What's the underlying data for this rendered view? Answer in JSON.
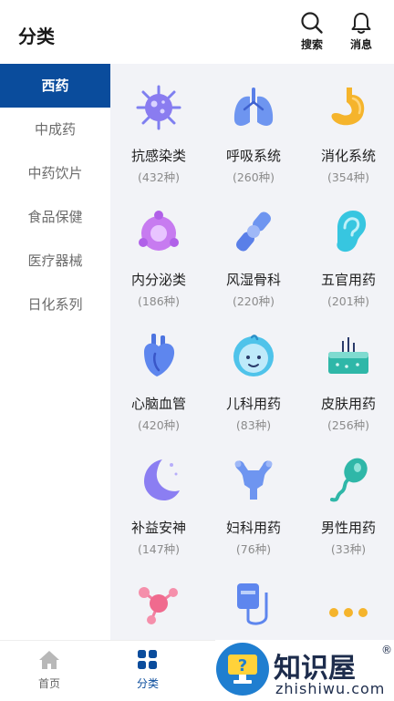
{
  "header": {
    "title": "分类",
    "search_label": "搜索",
    "message_label": "消息"
  },
  "sidebar": {
    "items": [
      {
        "label": "西药",
        "active": true
      },
      {
        "label": "中成药"
      },
      {
        "label": "中药饮片"
      },
      {
        "label": "食品保健"
      },
      {
        "label": "医疗器械"
      },
      {
        "label": "日化系列"
      }
    ]
  },
  "categories": [
    {
      "name": "抗感染类",
      "count": "(432种)",
      "icon": "virus-icon"
    },
    {
      "name": "呼吸系统",
      "count": "(260种)",
      "icon": "lungs-icon"
    },
    {
      "name": "消化系统",
      "count": "(354种)",
      "icon": "stomach-icon"
    },
    {
      "name": "内分泌类",
      "count": "(186种)",
      "icon": "gland-icon"
    },
    {
      "name": "风湿骨科",
      "count": "(220种)",
      "icon": "bone-joint-icon"
    },
    {
      "name": "五官用药",
      "count": "(201种)",
      "icon": "ear-icon"
    },
    {
      "name": "心脑血管",
      "count": "(420种)",
      "icon": "heart-icon"
    },
    {
      "name": "儿科用药",
      "count": "(83种)",
      "icon": "baby-icon"
    },
    {
      "name": "皮肤用药",
      "count": "(256种)",
      "icon": "skin-icon"
    },
    {
      "name": "补益安神",
      "count": "(147种)",
      "icon": "moon-icon"
    },
    {
      "name": "妇科用药",
      "count": "(76种)",
      "icon": "uterus-icon"
    },
    {
      "name": "男性用药",
      "count": "(33种)",
      "icon": "sperm-icon"
    },
    {
      "name": "",
      "count": "",
      "icon": "molecule-icon"
    },
    {
      "name": "",
      "count": "",
      "icon": "iv-drip-icon"
    },
    {
      "name": "",
      "count": "",
      "icon": "more-dots-icon"
    }
  ],
  "tabbar": {
    "home_label": "首页",
    "category_label": "分类"
  },
  "watermark": {
    "text": "知识屋",
    "url": "zhishiwu.com",
    "reg": "®"
  },
  "colors": {
    "brand": "#0a4c9c",
    "active_tab": "#0a4c9c"
  }
}
